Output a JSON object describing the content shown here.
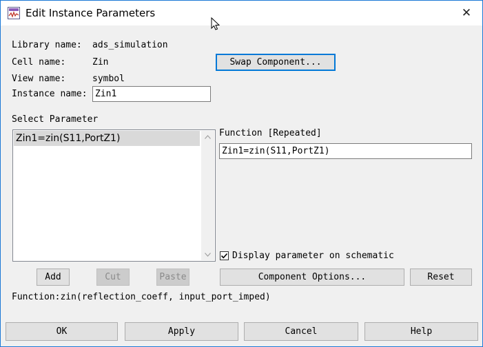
{
  "window": {
    "title": "Edit Instance Parameters",
    "close_label": "✕"
  },
  "info": {
    "library_label": "Library name:",
    "library_value": "ads_simulation",
    "cell_label": "Cell name:",
    "cell_value": "Zin",
    "view_label": "View name:",
    "view_value": "symbol",
    "instance_label": "Instance name:",
    "instance_value": "Zin1"
  },
  "buttons": {
    "swap_component": "Swap Component...",
    "add": "Add",
    "cut": "Cut",
    "paste": "Paste",
    "component_options": "Component Options...",
    "reset": "Reset",
    "ok": "OK",
    "apply": "Apply",
    "cancel": "Cancel",
    "help": "Help"
  },
  "parameters": {
    "section_label": "Select Parameter",
    "items": [
      "Zin1=zin(S11,PortZ1)"
    ],
    "selected_index": 0
  },
  "function_panel": {
    "label": "Function [Repeated]",
    "value": "Zin1=zin(S11,PortZ1)"
  },
  "display_checkbox": {
    "label": "Display parameter on schematic",
    "checked": true
  },
  "function_help": "Function:zin(reflection_coeff, input_port_imped)",
  "colors": {
    "dialog_bg": "#f0f0f0",
    "focus_border": "#0078d7",
    "selection_bg": "#d9d9d9"
  }
}
